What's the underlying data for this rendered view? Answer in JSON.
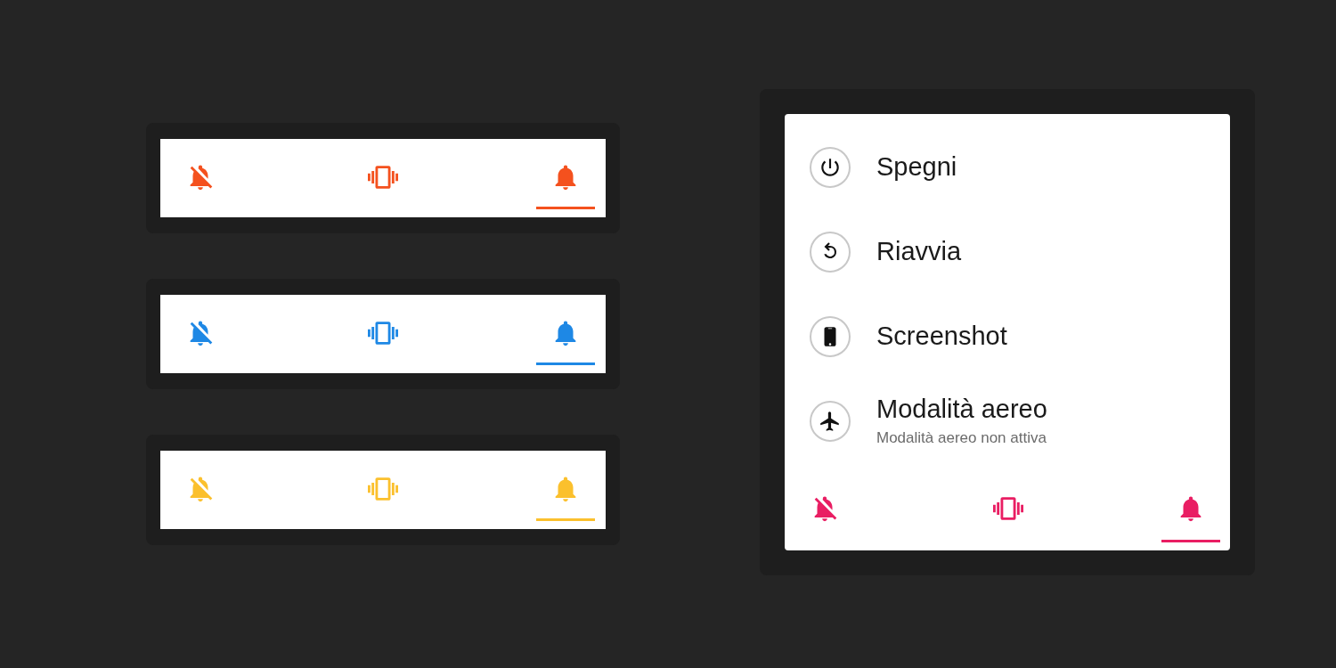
{
  "sound_bars": [
    {
      "color": "#f4511e",
      "modes": [
        {
          "kind": "mute",
          "selected": false
        },
        {
          "kind": "vibrate",
          "selected": false
        },
        {
          "kind": "sound",
          "selected": true
        }
      ]
    },
    {
      "color": "#1e88e5",
      "modes": [
        {
          "kind": "mute",
          "selected": false
        },
        {
          "kind": "vibrate",
          "selected": false
        },
        {
          "kind": "sound",
          "selected": true
        }
      ]
    },
    {
      "color": "#fbc02d",
      "modes": [
        {
          "kind": "mute",
          "selected": false
        },
        {
          "kind": "vibrate",
          "selected": false
        },
        {
          "kind": "sound",
          "selected": true
        }
      ]
    }
  ],
  "power_menu": {
    "items": [
      {
        "kind": "power",
        "label": "Spegni"
      },
      {
        "kind": "restart",
        "label": "Riavvia"
      },
      {
        "kind": "screenshot",
        "label": "Screenshot"
      },
      {
        "kind": "airplane",
        "label": "Modalità aereo",
        "sublabel": "Modalità aereo non attiva"
      }
    ],
    "sound_bar": {
      "color": "#e91e63",
      "modes": [
        {
          "kind": "mute",
          "selected": false
        },
        {
          "kind": "vibrate",
          "selected": false
        },
        {
          "kind": "sound",
          "selected": true
        }
      ]
    }
  }
}
